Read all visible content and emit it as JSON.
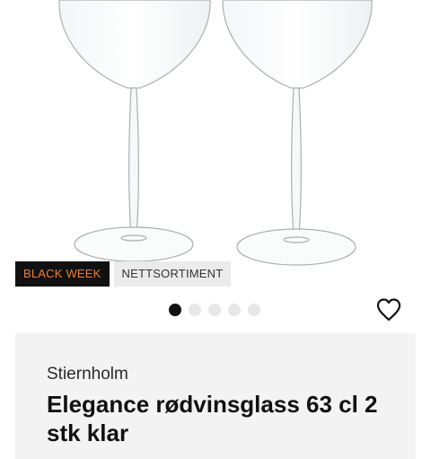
{
  "badges": {
    "black_week": "BLACK WEEK",
    "online": "NETTSORTIMENT"
  },
  "carousel": {
    "count": 5,
    "active": 1
  },
  "product": {
    "brand": "Stiernholm",
    "title": "Elegance rødvinsglass 63 cl 2 stk klar"
  },
  "icons": {
    "favorite": "heart-outline-icon"
  },
  "colors": {
    "badge_accent": "#f27c2f",
    "badge_dark": "#111111"
  }
}
